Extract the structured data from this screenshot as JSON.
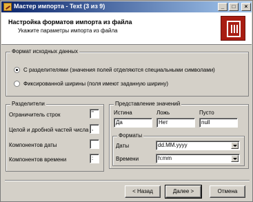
{
  "window": {
    "title": "Мастер импорта - Text (3 из 9)",
    "controls": {
      "minimize": "_",
      "maximize": "□",
      "close": "×"
    }
  },
  "header": {
    "title": "Настройка форматов импорта из файла",
    "subtitle": "Укажите параметры импорта из файла",
    "logo_icon": "table-import-icon"
  },
  "source_format": {
    "legend": "Формат исходных данных",
    "options": [
      {
        "label": "С разделителями (значения полей отделяются специальными символами)",
        "checked": true
      },
      {
        "label": "Фиксированной ширины (поля имеют заданную ширину)",
        "checked": false
      }
    ]
  },
  "separators": {
    "legend": "Разделители",
    "rows": [
      {
        "label": "Ограничитель строк",
        "value": "\""
      },
      {
        "label": "Целой и дробной частей числа",
        "value": ","
      },
      {
        "label": "Компонентов даты",
        "value": ""
      },
      {
        "label": "Компонентов времени",
        "value": ":"
      }
    ]
  },
  "value_representation": {
    "legend": "Представление значений",
    "fields": [
      {
        "label": "Истина",
        "value": "Да"
      },
      {
        "label": "Ложь",
        "value": "Нет"
      },
      {
        "label": "Пусто",
        "value": "null"
      }
    ]
  },
  "formats": {
    "legend": "Форматы",
    "date": {
      "label": "Даты",
      "value": "dd.MM.yyyy"
    },
    "time": {
      "label": "Времени",
      "value": "h:mm"
    }
  },
  "buttons": {
    "back": "< Назад",
    "next": "Далее >",
    "cancel": "Отмена"
  }
}
